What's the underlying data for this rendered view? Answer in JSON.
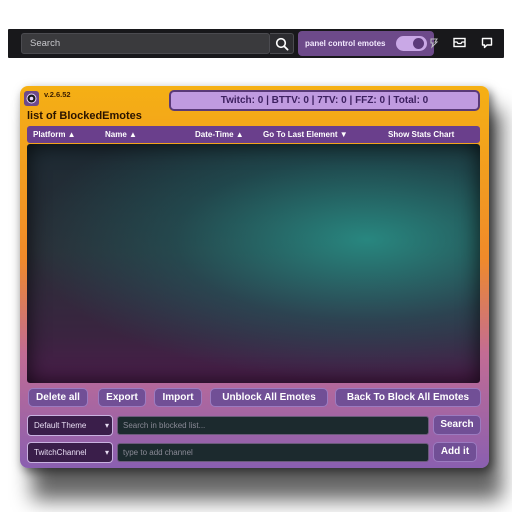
{
  "topbar": {
    "search_placeholder": "Search",
    "toggle_label": "panel control emotes",
    "toggle_on": true
  },
  "panel": {
    "version": "v.2.6.52",
    "title": "list of BlockedEmotes",
    "counter": "Twitch: 0 | BTTV: 0 | 7TV: 0 | FFZ: 0 | Total: 0",
    "columns": [
      "Platform ▲",
      "Name ▲",
      "Date-Time ▲",
      "Go To Last Element ▼",
      "Show Stats Chart"
    ],
    "buttons": {
      "delete_all": "Delete all",
      "export": "Export",
      "import": "Import",
      "unblock_all": "Unblock All Emotes",
      "back_to_block": "Back To Block All Emotes"
    },
    "theme_select": "Default Theme",
    "search_placeholder": "Search in blocked list...",
    "search_button": "Search",
    "platform_select": "TwitchChannel",
    "channel_placeholder": "type to add channel",
    "add_button": "Add it"
  },
  "colors": {
    "panel_top": "#f5b014",
    "panel_bottom": "#8a5fb0",
    "accent_purple": "#714f96",
    "counter_bg": "#c09be0"
  }
}
